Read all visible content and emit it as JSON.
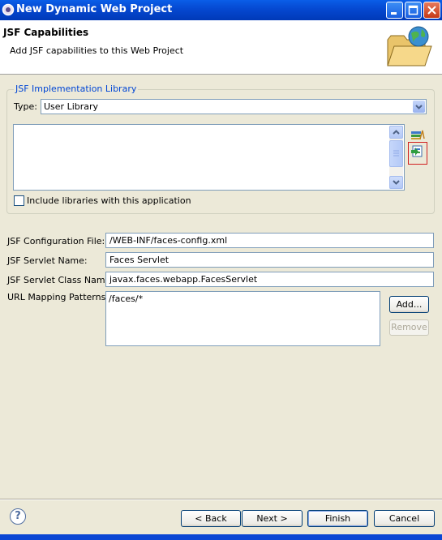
{
  "window": {
    "title": "New Dynamic Web Project"
  },
  "banner": {
    "title": "JSF Capabilities",
    "description": "Add JSF capabilities to this Web Project",
    "icon": "folder-globe-icon"
  },
  "library_group": {
    "legend": "JSF Implementation Library",
    "type_label": "Type:",
    "type_value": "User Library",
    "include_checkbox_label": "Include libraries with this application",
    "include_checked": false,
    "side_icons": [
      "manage-libraries-icon",
      "download-library-icon"
    ]
  },
  "config": {
    "config_file_label": "JSF Configuration File:",
    "config_file_value": "/WEB-INF/faces-config.xml",
    "servlet_name_label": "JSF Servlet Name:",
    "servlet_name_value": "Faces Servlet",
    "servlet_class_label": "JSF Servlet Class Name:",
    "servlet_class_value": "javax.faces.webapp.FacesServlet",
    "url_label": "URL Mapping Patterns:",
    "url_patterns": [
      "/faces/*"
    ],
    "add_label": "Add...",
    "remove_label": "Remove"
  },
  "footer": {
    "help_glyph": "?",
    "back_label": "< Back",
    "next_label": "Next >",
    "finish_label": "Finish",
    "cancel_label": "Cancel"
  },
  "colors": {
    "title_bar": "#0A5EE8",
    "dialog_bg": "#ECE9D8",
    "legend": "#0046D5",
    "highlight_box": "#D02020"
  }
}
